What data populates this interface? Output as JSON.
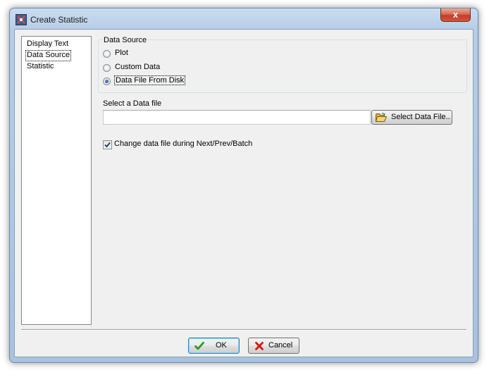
{
  "window": {
    "title": "Create Statistic",
    "close_label": "x"
  },
  "nav": {
    "items": [
      {
        "label": "Display Text",
        "selected": false
      },
      {
        "label": "Data Source",
        "selected": true
      },
      {
        "label": "Statistic",
        "selected": false
      }
    ]
  },
  "data_source": {
    "group_title": "Data Source",
    "options": [
      {
        "label": "Plot",
        "checked": false
      },
      {
        "label": "Custom Data",
        "checked": false
      },
      {
        "label": "Data File From Disk",
        "checked": true
      }
    ]
  },
  "file": {
    "label": "Select a Data file",
    "value": "",
    "button_label": "Select Data File.."
  },
  "change_file": {
    "label": "Change data file during Next/Prev/Batch",
    "checked": true
  },
  "buttons": {
    "ok_label": "OK",
    "cancel_label": "Cancel"
  },
  "icons": {
    "app": "flowjo-statistic-icon",
    "folder": "folder-open-icon",
    "ok": "check-icon",
    "cancel": "x-icon"
  },
  "colors": {
    "ok_icon": "#2a9a1f",
    "cancel_icon": "#d01a10",
    "close_button": "#c53d27",
    "radio_dot": "#1a3f78"
  }
}
